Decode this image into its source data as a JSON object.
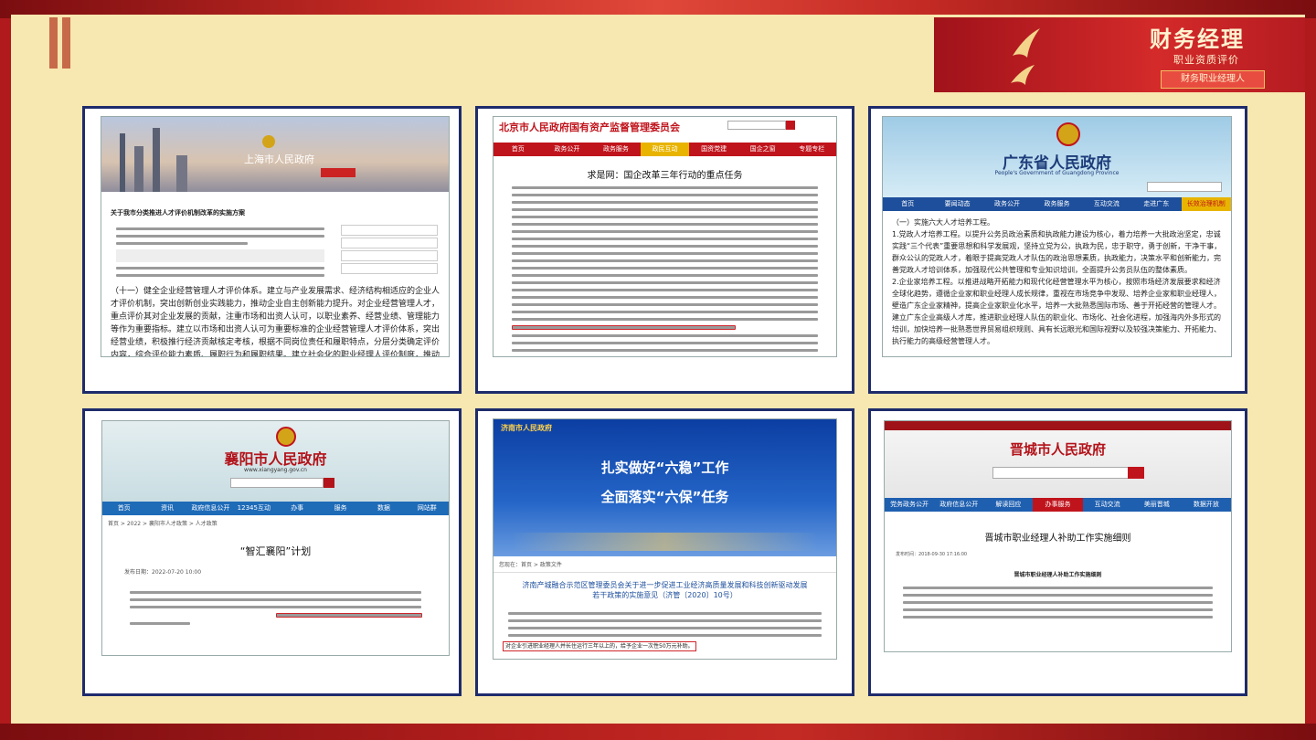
{
  "brand": {
    "title": "财务经理",
    "subtitle": "职业资质评价",
    "tag": "财务职业经理人"
  },
  "card1": {
    "banner_title": "上海市人民政府",
    "article_title": "关于我市分类推进人才评价机制改革的实施方案",
    "body": "（十一）健全企业经营管理人才评价体系。建立与产业发展需求、经济结构相适应的企业人才评价机制，突出创新创业实践能力，推动企业自主创新能力提升。对企业经营管理人才，重点评价其对企业发展的贡献，注重市场和出资人认可，以职业素养、经营业绩、管理能力等作为重要指标。建立以市场和出资人认可为重要标准的企业经营管理人才评价体系，突出经营业绩，积极推行经济贡献核定考核，根据不同岗位责任和履职特点，分层分类确定评价内容，综合评价能力素质、履职行为和履职结果。建立社会化的职业经理人评价制度，推动职业经理人队伍的市场化、专业化、国际化。",
    "highlight": "职业经理人"
  },
  "card2": {
    "site_title": "北京市人民政府国有资产监督管理委员会",
    "nav": [
      "首页",
      "政务公开",
      "政务服务",
      "政民互动",
      "国资党建",
      "国企之窗",
      "专题专栏"
    ],
    "article_title": "求是网：国企改革三年行动的重点任务"
  },
  "card3": {
    "site_title": "广东省人民政府",
    "site_en": "People's Government of Guangdong Province",
    "nav": [
      "首页",
      "要闻动态",
      "政务公开",
      "政务服务",
      "互动交流",
      "走进广东",
      "长效治理机制"
    ],
    "section": "（一）实施六大人才培养工程。",
    "p1": "1.党政人才培养工程。以提升公务员政治素质和执政能力建设为核心，着力培养一大批政治坚定，忠诚实践“三个代表”重要思想和科学发展观，坚持立党为公，执政为民，忠于职守，勇于创新，干净干事，群众公认的党政人才，着眼于提高党政人才队伍的政治思想素质，执政能力，决策水平和创新能力，完善党政人才培训体系，加强现代公共管理和专业知识培训，全面提升公务员队伍的整体素质。",
    "p2": "2.企业家培养工程。以推进战略开拓能力和现代化经营管理水平为核心，按照市场经济发展要求和经济全球化趋势，遵循企业家和职业经理人成长规律，重视在市场竞争中发现、培养企业家和职业经理人，壁造广东企业家精神，提高企业家职业化水平，培养一大批熟悉国际市场、善于开拓经营的管理人才。建立广东企业高级人才库，推进职业经理人队伍的职业化、市场化、社会化进程，加强海内外多形式的培训，加快培养一批熟悉世界贸易组织规则、具有长远眼光和国际视野以及较强决策能力、开拓能力、执行能力的高级经营管理人才。"
  },
  "card4": {
    "site_title": "襄阳市人民政府",
    "site_url": "www.xiangyang.gov.cn",
    "nav": [
      "首页",
      "资讯",
      "政府信息公开",
      "12345互动",
      "办事",
      "服务",
      "数据",
      "网站群"
    ],
    "breadcrumb": "首页 > 2022 > 襄阳市人才政策 > 人才政策",
    "article_title": "“智汇襄阳”计划",
    "meta": "发布日期：2022-07-20 10:00"
  },
  "card5": {
    "site_title": "济南市人民政府",
    "banner_line1": "扎实做好“六稳”工作",
    "banner_line2": "全面落实“六保”任务",
    "breadcrumb": "您现在：首页 > 政策文件",
    "article_title": "济南产城融合示范区管理委员会关于进一步促进工业经济高质量发展和科技创新驱动发展若干政策的实施意见（济管〔2020〕10号）",
    "highlight": "对企业引进职业经理人并长住运行三年以上的，给予企业一次性50万元补助。"
  },
  "card6": {
    "site_title": "晋城市人民政府",
    "nav": [
      "党务政务公开",
      "政府信息公开",
      "解读回应",
      "办事服务",
      "互动交流",
      "美丽晋城",
      "数据开放"
    ],
    "article_title": "晋城市职业经理人补助工作实施细则",
    "sub_title": "晋城市职业经理人补助工作实施细则",
    "meta": "发布时间：2018-09-30 17:16:00"
  }
}
